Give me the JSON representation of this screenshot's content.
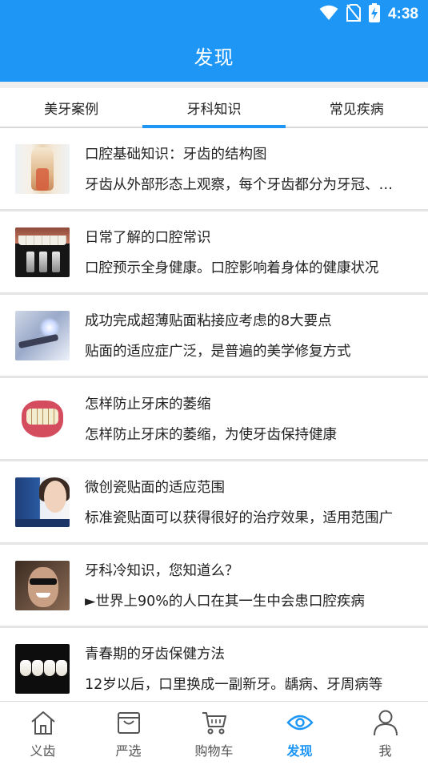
{
  "status_bar": {
    "time": "4:38",
    "icons": [
      "wifi-icon",
      "no-sim-icon",
      "battery-charging-icon"
    ]
  },
  "app_bar": {
    "title": "发现"
  },
  "tabs": [
    {
      "label": "美牙案例",
      "active": false
    },
    {
      "label": "牙科知识",
      "active": true
    },
    {
      "label": "常见疾病",
      "active": false
    }
  ],
  "articles": [
    {
      "title": "口腔基础知识：牙齿的结构图",
      "summary": "牙齿从外部形态上观察，每个牙齿都分为牙冠、牙根和牙颈三部分"
    },
    {
      "title": "日常了解的口腔常识",
      "summary": "口腔预示全身健康。口腔影响着身体的健康状况"
    },
    {
      "title": "成功完成超薄贴面粘接应考虑的8大要点",
      "summary": "贴面的适应症广泛，是普遍的美学修复方式"
    },
    {
      "title": "怎样防止牙床的萎缩",
      "summary": "怎样防止牙床的萎缩，为使牙齿保持健康"
    },
    {
      "title": "微创瓷贴面的适应范围",
      "summary": "标准瓷贴面可以获得很好的治疗效果，适用范围广"
    },
    {
      "title": "牙科冷知识，您知道么？",
      "summary": "►世界上90%的人口在其一生中会患口腔疾病"
    },
    {
      "title": "青春期的牙齿保健方法",
      "summary": "12岁以后，口里换成一副新牙。龋病、牙周病等"
    }
  ],
  "bottom_nav": [
    {
      "label": "义齿",
      "icon": "home-icon",
      "active": false
    },
    {
      "label": "严选",
      "icon": "shopping-bag-icon",
      "active": false
    },
    {
      "label": "购物车",
      "icon": "cart-icon",
      "active": false
    },
    {
      "label": "发现",
      "icon": "eye-icon",
      "active": true
    },
    {
      "label": "我",
      "icon": "user-icon",
      "active": false
    }
  ],
  "colors": {
    "primary": "#1e96f5",
    "text": "#222222",
    "nav_inactive": "#555555"
  }
}
